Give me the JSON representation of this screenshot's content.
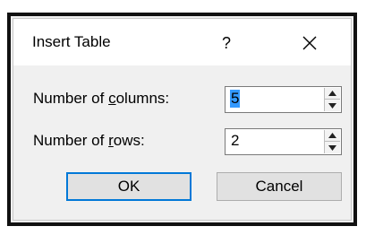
{
  "dialog": {
    "title": "Insert Table",
    "help_label": "?",
    "close_icon": "close-icon"
  },
  "columns": {
    "label_prefix": "Number of ",
    "label_accel": "c",
    "label_suffix": "olumns:",
    "value": "5"
  },
  "rows": {
    "label_prefix": "Number of ",
    "label_accel": "r",
    "label_suffix": "ows:",
    "value": "2"
  },
  "buttons": {
    "ok": "OK",
    "cancel": "Cancel"
  },
  "icons": {
    "spin_up": "triangle-up-icon",
    "spin_down": "triangle-down-icon"
  }
}
